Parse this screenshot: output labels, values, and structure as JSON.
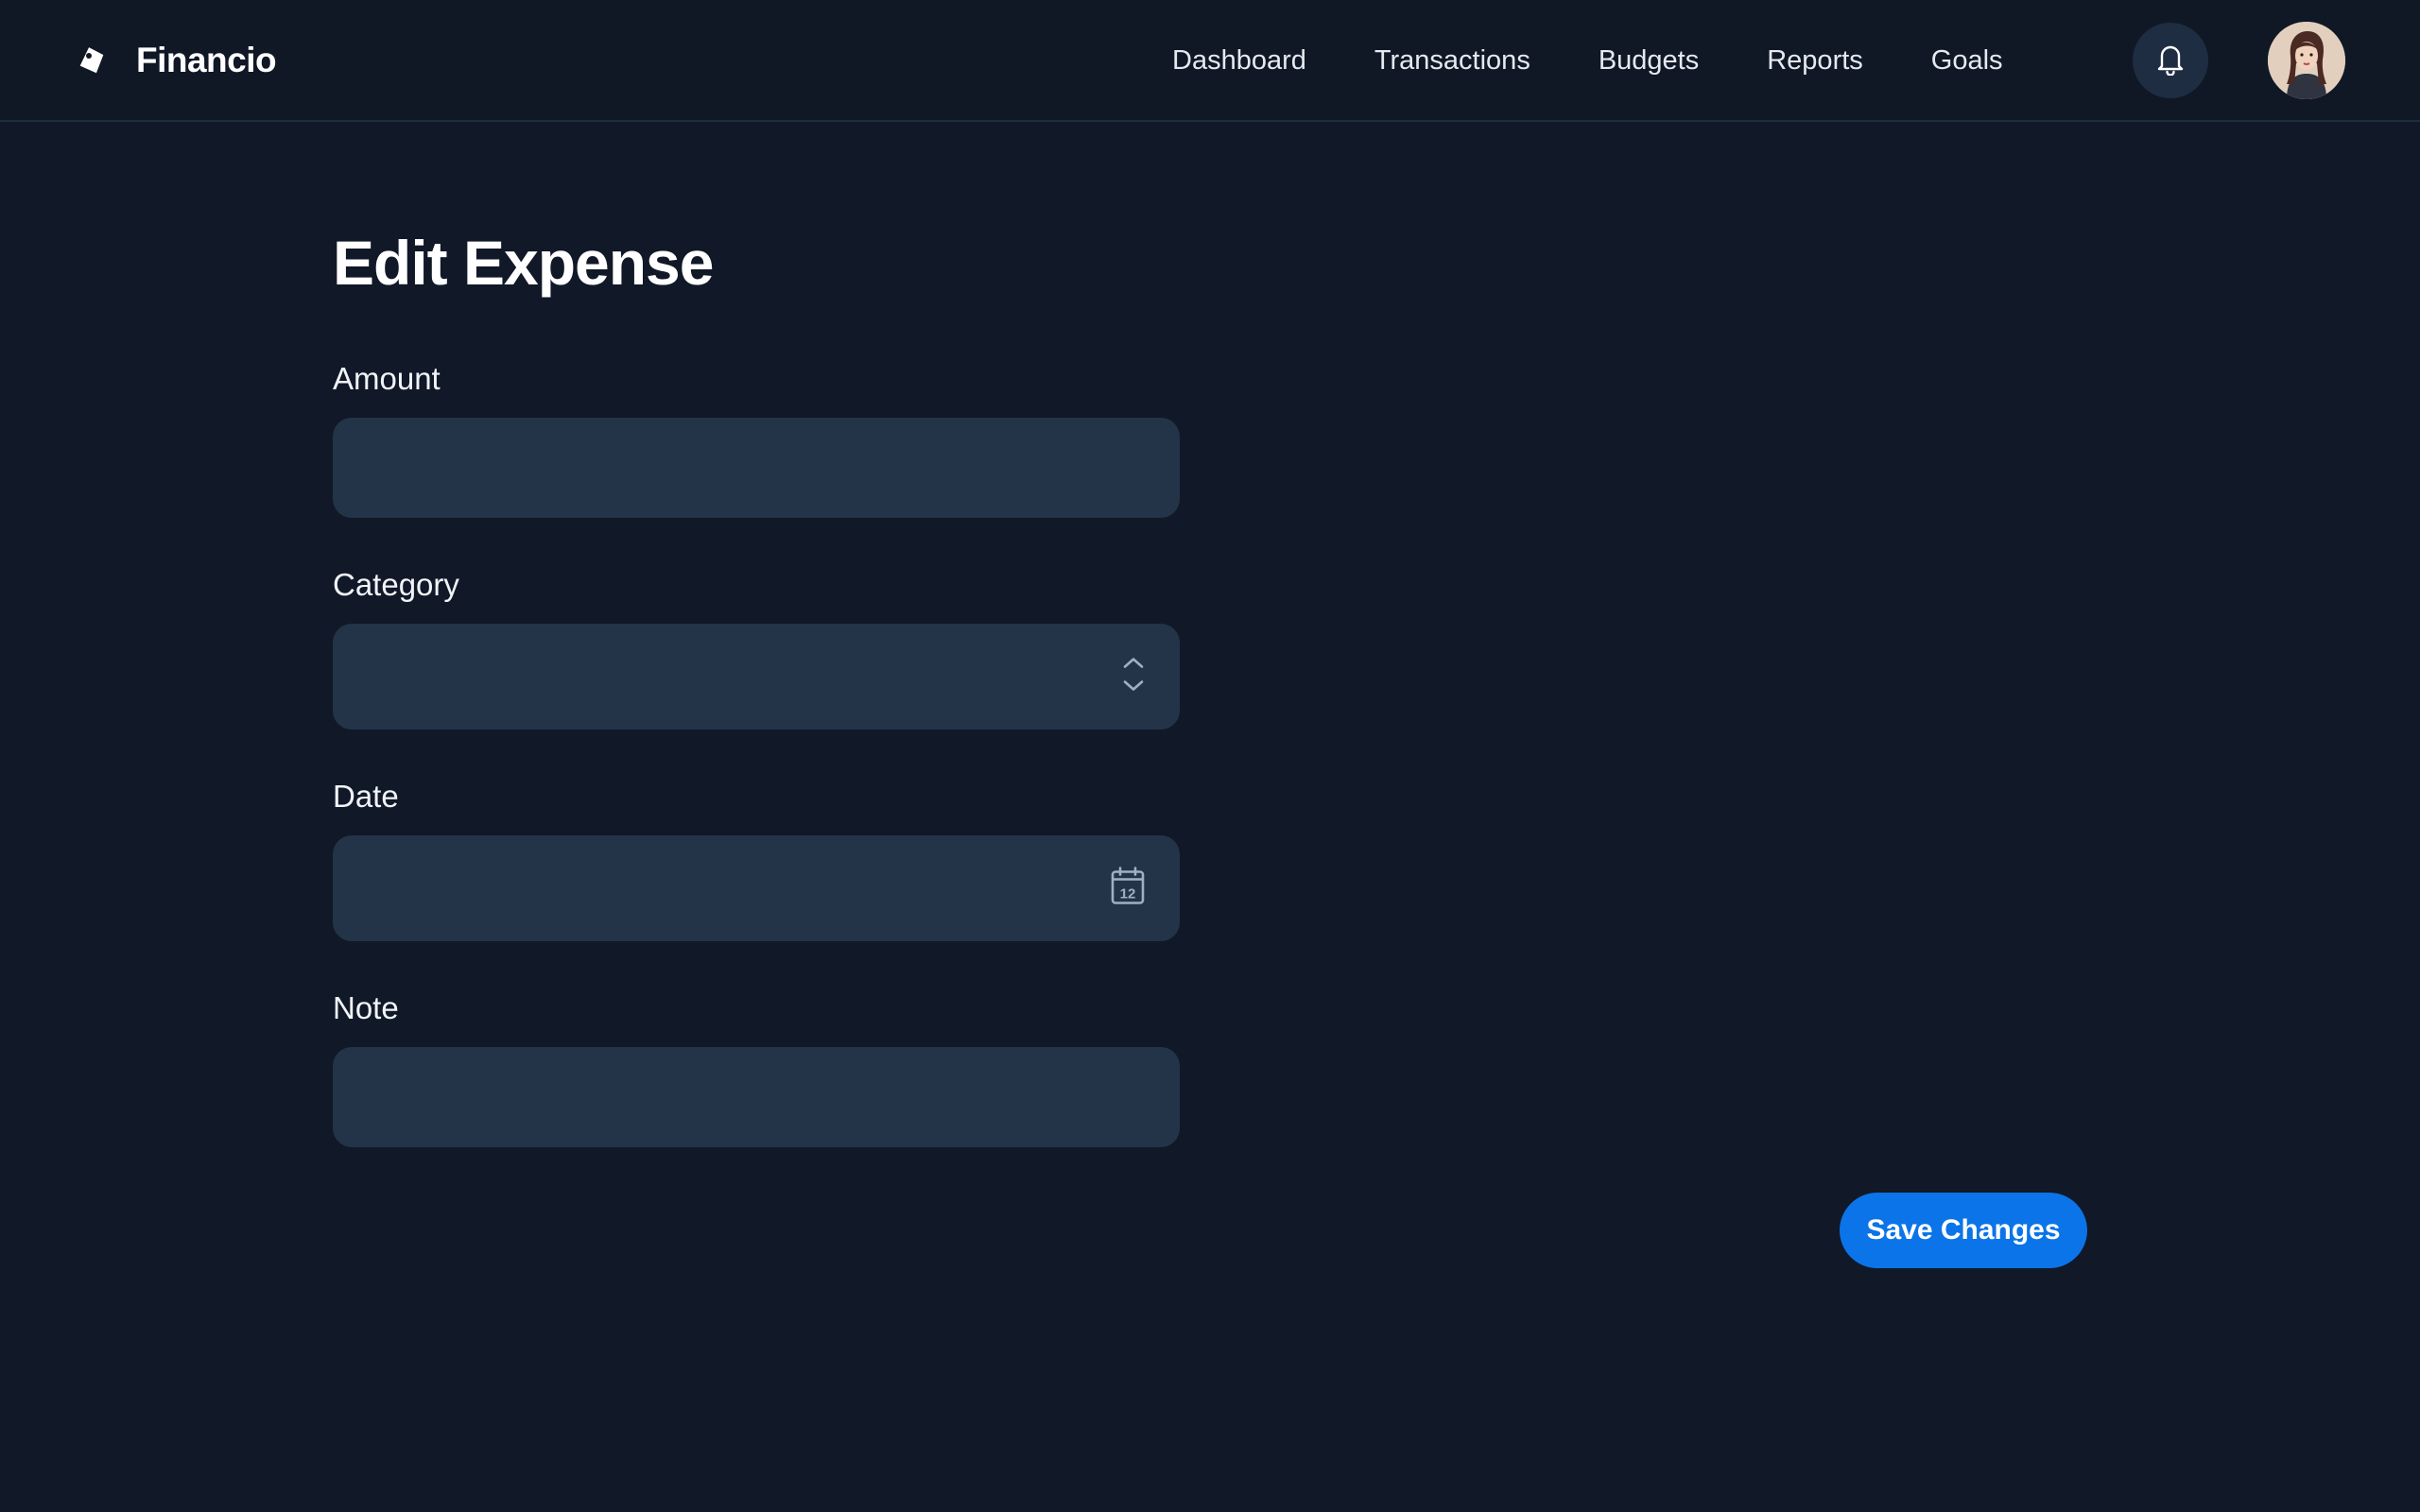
{
  "app": {
    "name": "Financio",
    "logo_icon": "tag-icon"
  },
  "nav": {
    "items": [
      {
        "label": "Dashboard"
      },
      {
        "label": "Transactions"
      },
      {
        "label": "Budgets"
      },
      {
        "label": "Reports"
      },
      {
        "label": "Goals"
      }
    ],
    "notifications_icon": "bell-icon",
    "avatar": "user-avatar"
  },
  "page": {
    "title": "Edit Expense"
  },
  "form": {
    "amount": {
      "label": "Amount",
      "value": "",
      "placeholder": ""
    },
    "category": {
      "label": "Category",
      "value": "",
      "icon": "chevron-updown-icon"
    },
    "date": {
      "label": "Date",
      "value": "",
      "icon": "calendar-icon",
      "calendar_day": "12"
    },
    "note": {
      "label": "Note",
      "value": "",
      "placeholder": ""
    }
  },
  "actions": {
    "save_label": "Save Changes"
  },
  "colors": {
    "background": "#111827",
    "header": "#101826",
    "field": "#233449",
    "accent": "#0b74e8"
  }
}
